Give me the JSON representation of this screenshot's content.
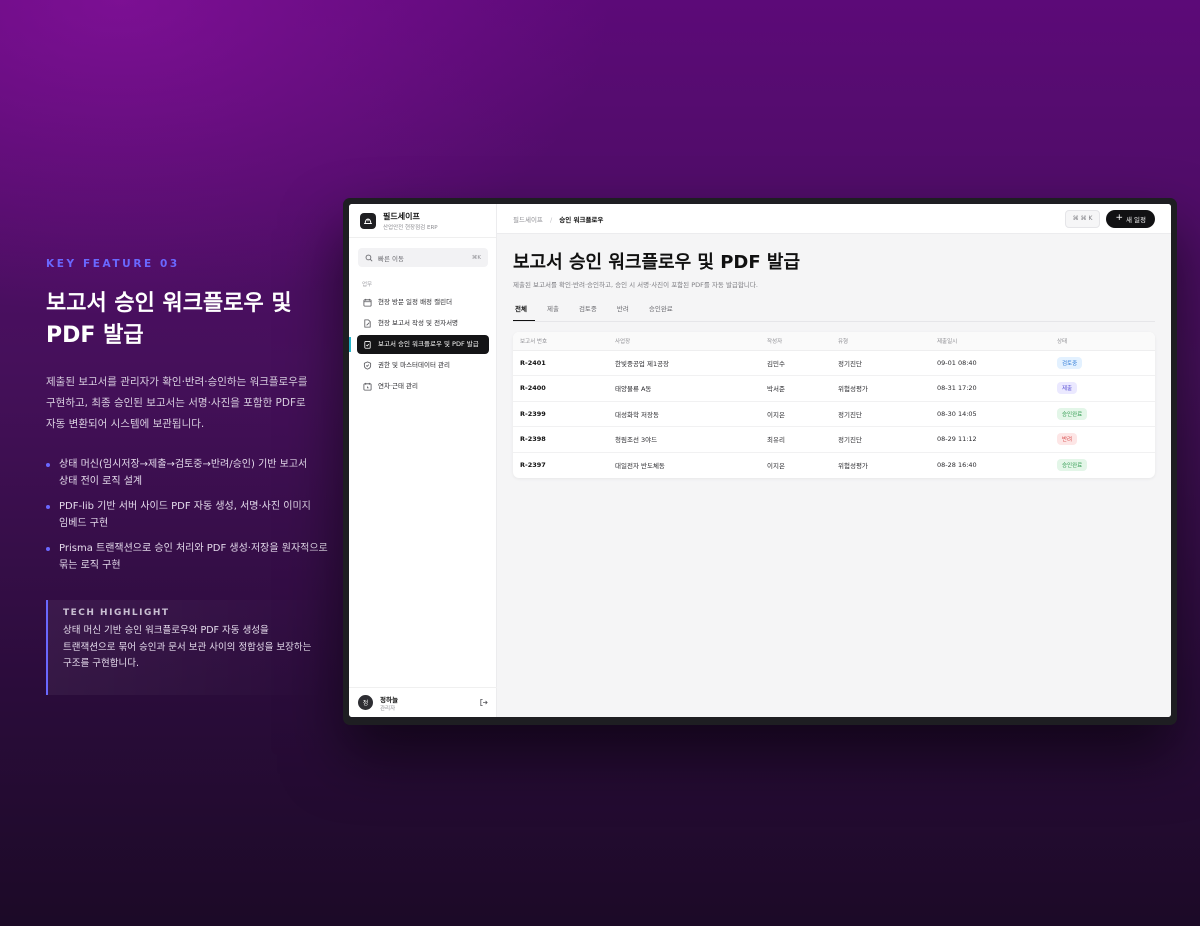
{
  "hero": {
    "kicker": "KEY FEATURE 03",
    "title_line1": "보고서 승인 워크플로우 및",
    "title_line2": "PDF 발급",
    "desc_line1": "제출된 보고서를 관리자가 확인·반려·승인하는 워크플로우를",
    "desc_line2": "구현하고, 최종 승인된 보고서는 서명·사진을 포함한 PDF로",
    "desc_line3": "자동 변환되어 시스템에 보관됩니다.",
    "bullets": [
      {
        "l1": "상태 머신(임시저장→제출→검토중→반려/승인) 기반 보고서",
        "l2": "상태 전이 로직 설계"
      },
      {
        "l1": "PDF-lib 기반 서버 사이드 PDF 자동 생성, 서명·사진 이미지",
        "l2": "임베드 구현"
      },
      {
        "l1": "Prisma 트랜잭션으로 승인 처리와 PDF 생성·저장을 원자적으로",
        "l2": "묶는 로직 구현"
      }
    ],
    "tech_title": "TECH HIGHLIGHT",
    "tech_line1": "상태 머신 기반 승인 워크플로우와 PDF 자동 생성을",
    "tech_line2": "트랜잭션으로 묶어 승인과 문서 보관 사이의 정합성을 보장하는",
    "tech_line3": "구조를 구현합니다."
  },
  "app": {
    "brand_name": "필드세이프",
    "brand_sub": "산업안전 현장점검 ERP",
    "quick_search": "빠른 이동",
    "quick_kbd": "⌘K",
    "nav_section": "업무",
    "nav": [
      {
        "label": "현장 방문 일정 배정 캘린더",
        "icon": "calendar-icon"
      },
      {
        "label": "현장 보고서 작성 및 전자서명",
        "icon": "document-edit-icon"
      },
      {
        "label": "보고서 승인 워크플로우 및 PDF 발급",
        "icon": "clipboard-check-icon"
      },
      {
        "label": "권한 및 마스터데이터 관리",
        "icon": "shield-check-icon"
      },
      {
        "label": "연차·근태 관리",
        "icon": "calendar-clock-icon"
      }
    ],
    "user_avatar": "정",
    "user_name": "정하늘",
    "user_role": "관리자",
    "breadcrumb_root": "필드세이프",
    "breadcrumb_sep": "/",
    "breadcrumb_current": "승인 워크플로우",
    "cmdk_label": "⌘ ⌘ K",
    "new_button_plus": "+",
    "new_button": "새 일정",
    "page_title": "보고서 승인 워크플로우 및 PDF 발급",
    "page_sub": "제출된 보고서를 확인·반려·승인하고, 승인 시 서명·사진이 포함된 PDF를 자동 발급합니다.",
    "tabs": [
      "전체",
      "제출",
      "검토중",
      "반려",
      "승인완료"
    ],
    "columns": [
      "보고서 번호",
      "사업장",
      "작성자",
      "유형",
      "제출일시",
      "상태"
    ],
    "rows": [
      {
        "id": "R-2401",
        "site": "한빛중공업 제1공장",
        "author": "김민수",
        "type": "정기진단",
        "date": "09-01 08:40",
        "status": "검토중"
      },
      {
        "id": "R-2400",
        "site": "태양물류 A동",
        "author": "박서준",
        "type": "위험성평가",
        "date": "08-31 17:20",
        "status": "제출"
      },
      {
        "id": "R-2399",
        "site": "대성화학 저장동",
        "author": "이지은",
        "type": "정기진단",
        "date": "08-30 14:05",
        "status": "승인완료"
      },
      {
        "id": "R-2398",
        "site": "청림조선 3야드",
        "author": "최유리",
        "type": "정기진단",
        "date": "08-29 11:12",
        "status": "반려"
      },
      {
        "id": "R-2397",
        "site": "대일전자 반도체동",
        "author": "이지은",
        "type": "위험성평가",
        "date": "08-28 16:40",
        "status": "승인완료"
      }
    ],
    "status_colors": {
      "검토중": {
        "bg": "#e3f1ff",
        "fg": "#2f7bd8"
      },
      "제출": {
        "bg": "#ebe9ff",
        "fg": "#5b52d6"
      },
      "승인완료": {
        "bg": "#e3f6e8",
        "fg": "#2f9a4f"
      },
      "반려": {
        "bg": "#fde6e6",
        "fg": "#d64545"
      }
    }
  }
}
